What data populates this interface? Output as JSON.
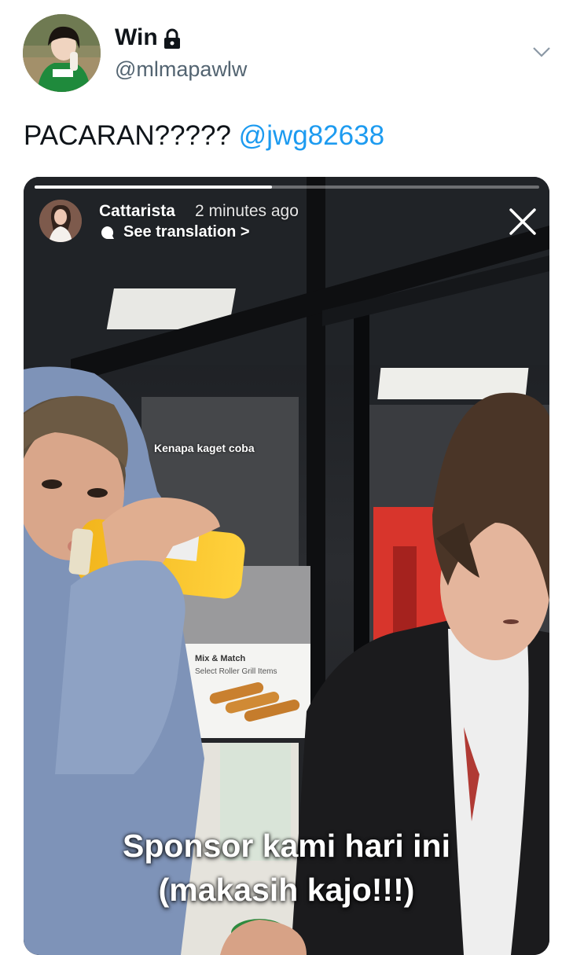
{
  "tweet": {
    "display_name": "Win",
    "handle": "@mlmapawlw",
    "text_prefix": "PACARAN????? ",
    "mention": "@jwg82638",
    "icons": {
      "lock": "lock-icon",
      "more": "chevron-down-icon"
    }
  },
  "story": {
    "username": "Cattarista",
    "time_ago": "2 minutes ago",
    "see_translation": "See translation >",
    "progress": 0.47,
    "caption_small": "Kenapa kaget coba",
    "caption_line1": "Sponsor kami hari ini",
    "caption_line2": "(makasih kajo!!!)",
    "icons": {
      "close": "close-icon",
      "translate": "translate-icon"
    },
    "sign_text": [
      "Mix & Match",
      "Select Roller Grill Items"
    ]
  },
  "colors": {
    "mention": "#1d9bf0",
    "handle": "#536471",
    "text": "#0f1419"
  }
}
